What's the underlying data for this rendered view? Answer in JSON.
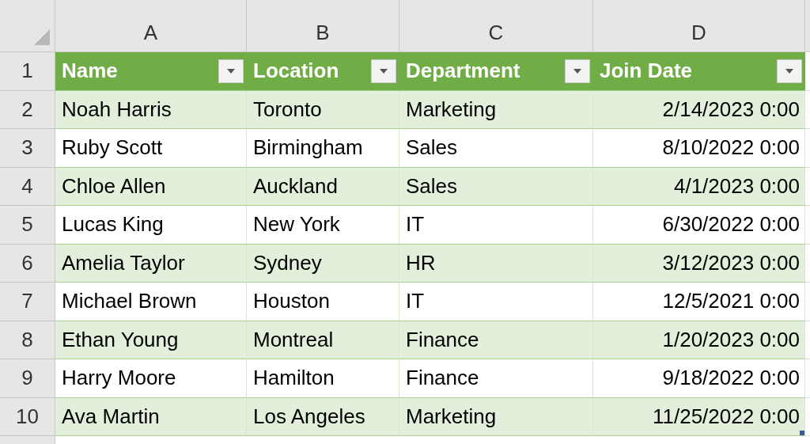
{
  "column_headers": [
    "A",
    "B",
    "C",
    "D"
  ],
  "row_numbers": [
    "1",
    "2",
    "3",
    "4",
    "5",
    "6",
    "7",
    "8",
    "9",
    "10"
  ],
  "table": {
    "columns": [
      {
        "label": "Name",
        "kind": "text"
      },
      {
        "label": "Location",
        "kind": "text"
      },
      {
        "label": "Department",
        "kind": "text"
      },
      {
        "label": "Join Date",
        "kind": "date"
      }
    ],
    "rows": [
      [
        "Noah Harris",
        "Toronto",
        "Marketing",
        "2/14/2023 0:00"
      ],
      [
        "Ruby Scott",
        "Birmingham",
        "Sales",
        "8/10/2022 0:00"
      ],
      [
        "Chloe Allen",
        "Auckland",
        "Sales",
        "4/1/2023 0:00"
      ],
      [
        "Lucas King",
        "New York",
        "IT",
        "6/30/2022 0:00"
      ],
      [
        "Amelia Taylor",
        "Sydney",
        "HR",
        "3/12/2023 0:00"
      ],
      [
        "Michael Brown",
        "Houston",
        "IT",
        "12/5/2021 0:00"
      ],
      [
        "Ethan Young",
        "Montreal",
        "Finance",
        "1/20/2023 0:00"
      ],
      [
        "Harry Moore",
        "Hamilton",
        "Finance",
        "9/18/2022 0:00"
      ],
      [
        "Ava Martin",
        "Los Angeles",
        "Marketing",
        "11/25/2022 0:00"
      ]
    ]
  }
}
